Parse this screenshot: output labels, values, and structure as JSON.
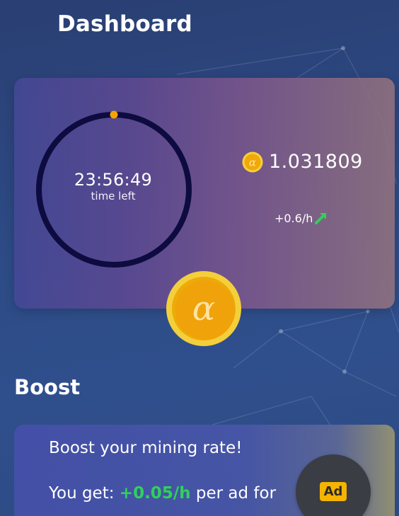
{
  "header": {
    "title": "Dashboard"
  },
  "mining": {
    "timer": "23:56:49",
    "timer_caption": "time left",
    "timer_progress": 0.0,
    "balance": "1.031809",
    "rate": "+0.6/h",
    "coin_icon": "alpha-coin-icon",
    "rate_icon": "trend-up-arrow-icon"
  },
  "boost": {
    "section_title": "Boost",
    "headline": "Boost your mining rate!",
    "desc_prefix": "You get: ",
    "desc_rate": "+0.05/h",
    "desc_suffix": " per ad for",
    "ad_badge": "Ad"
  },
  "colors": {
    "ring": "#0d0b3f",
    "ring_marker": "#f5a300",
    "coin_gold": "#f2b407",
    "rate_green": "#2fd15a",
    "ad_badge": "#f5b400"
  }
}
